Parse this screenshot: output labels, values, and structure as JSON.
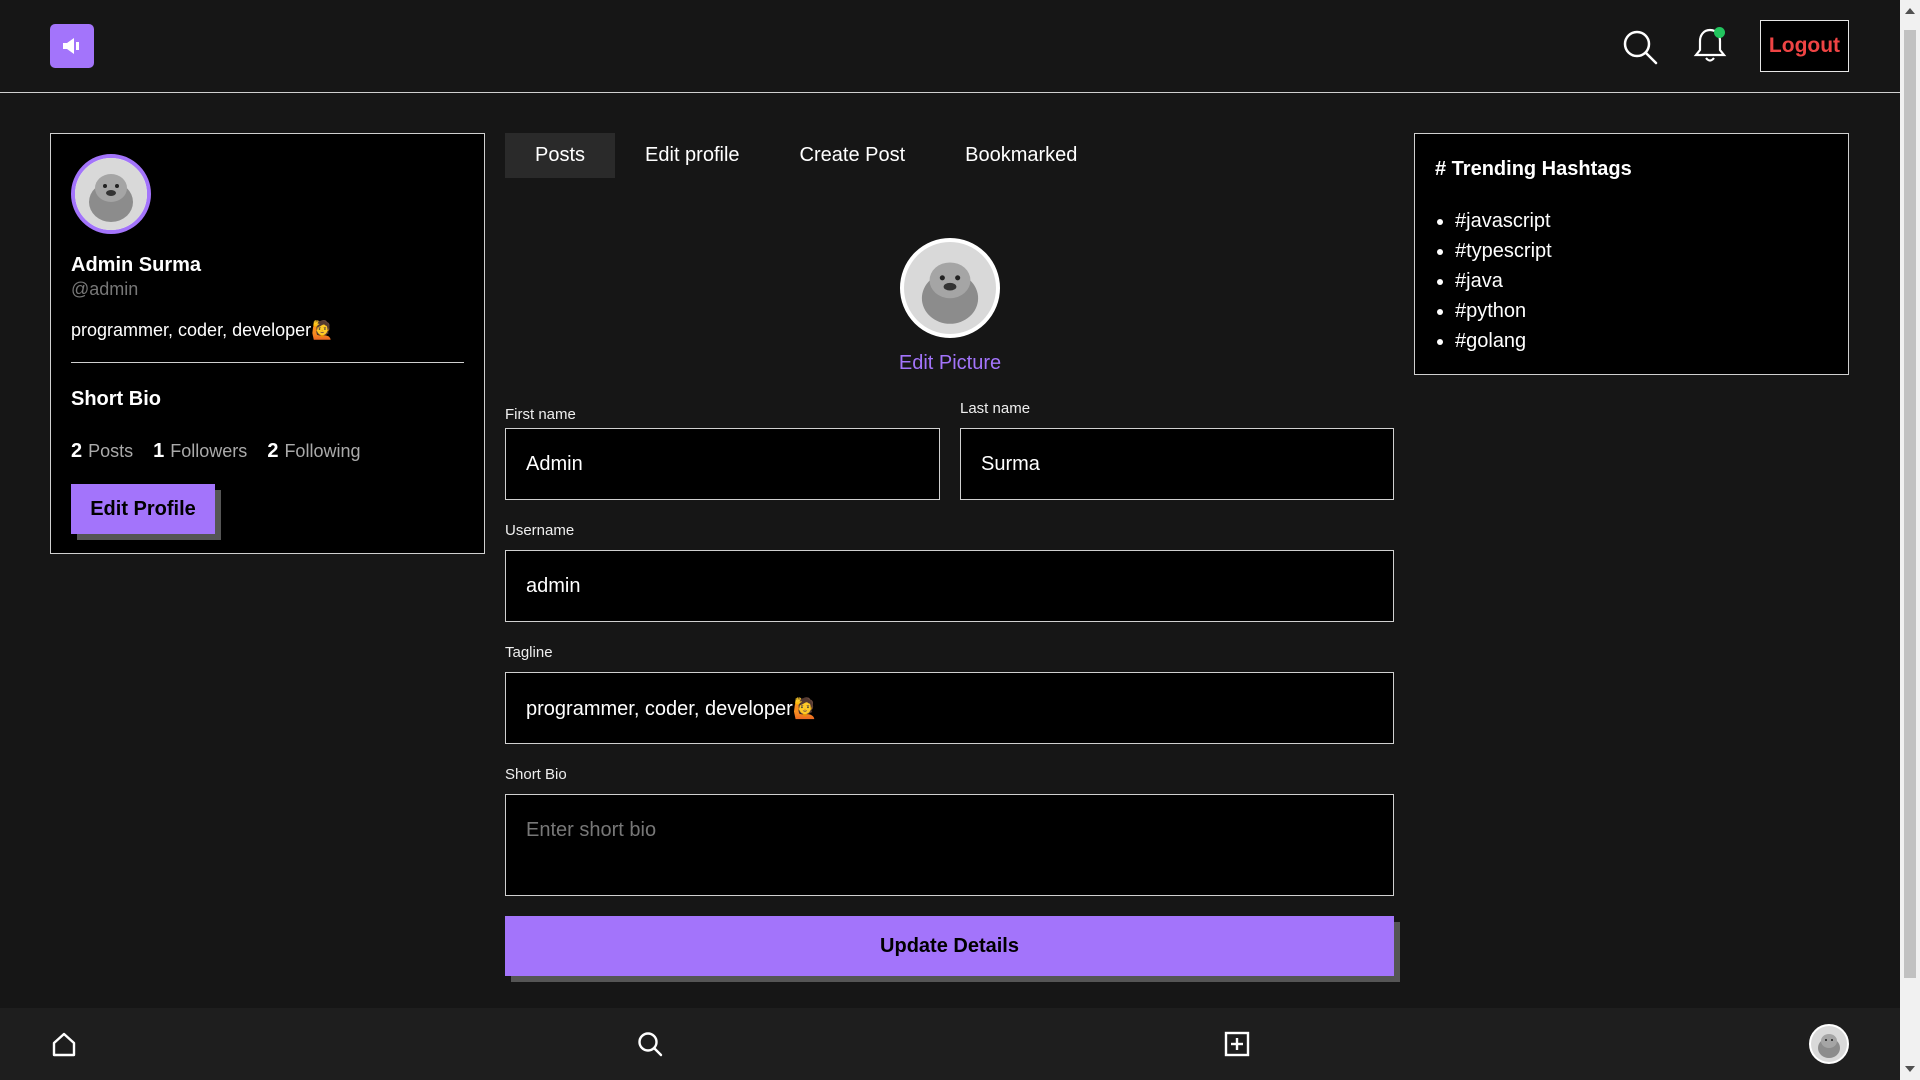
{
  "header": {
    "logout_label": "Logout"
  },
  "profile_card": {
    "name": "Admin Surma",
    "handle": "@admin",
    "tagline": "programmer, coder, developer🙋",
    "bio_title": "Short Bio",
    "stats": [
      {
        "num": "2",
        "label": "Posts"
      },
      {
        "num": "1",
        "label": "Followers"
      },
      {
        "num": "2",
        "label": "Following"
      }
    ],
    "edit_button": "Edit Profile"
  },
  "tabs": [
    "Posts",
    "Edit profile",
    "Create Post",
    "Bookmarked"
  ],
  "edit_picture": "Edit Picture",
  "form": {
    "first_name_label": "First name",
    "first_name_value": "Admin",
    "last_name_label": "Last name",
    "last_name_value": "Surma",
    "username_label": "Username",
    "username_value": "admin",
    "tagline_label": "Tagline",
    "tagline_value": "programmer, coder, developer🙋",
    "bio_label": "Short Bio",
    "bio_placeholder": "Enter short bio",
    "submit_label": "Update Details"
  },
  "trending": {
    "title": "# Trending Hashtags",
    "tags": [
      "#javascript",
      "#typescript",
      "#java",
      "#python",
      "#golang"
    ]
  },
  "colors": {
    "accent": "#a374fb",
    "logout": "#ef4444",
    "notification_dot": "#22c55e"
  },
  "icons": {
    "logo": "megaphone-icon",
    "search": "search-icon",
    "bell": "bell-icon",
    "home": "home-icon",
    "create": "plus-square-icon"
  }
}
